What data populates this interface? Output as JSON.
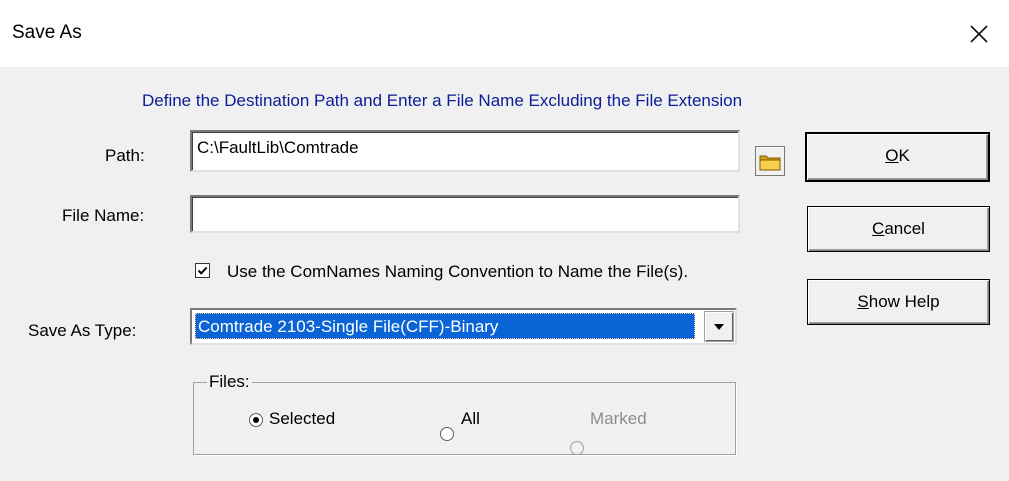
{
  "window": {
    "title": "Save As",
    "close_icon": "close-icon"
  },
  "instruction": "Define the Destination Path and Enter a File Name Excluding the File Extension",
  "path": {
    "label": "Path:",
    "value": "C:\\FaultLib\\Comtrade",
    "browse_icon": "folder-icon"
  },
  "file_name": {
    "label": "File Name:",
    "value": ""
  },
  "naming_convention": {
    "label": "Use the ComNames Naming Convention to Name the  File(s).",
    "checked": true
  },
  "save_as_type": {
    "label": "Save As Type:",
    "selected": "Comtrade 2103-Single File(CFF)-Binary"
  },
  "files_group": {
    "title": "Files:",
    "options": [
      {
        "label": "Selected",
        "selected": true,
        "enabled": true
      },
      {
        "label": "All",
        "selected": false,
        "enabled": true
      },
      {
        "label": "Marked",
        "selected": false,
        "enabled": false
      }
    ]
  },
  "buttons": {
    "ok": {
      "label": "OK",
      "mnemonic": "O",
      "rest": "K"
    },
    "cancel": {
      "label": "Cancel",
      "mnemonic": "C",
      "rest": "ancel"
    },
    "help": {
      "label": "Show Help",
      "mnemonic": "S",
      "rest": "how Help"
    }
  },
  "colors": {
    "instruction_text": "#0a1c96",
    "selection_highlight": "#0a64d6",
    "disabled_text": "#8d8d8d"
  }
}
